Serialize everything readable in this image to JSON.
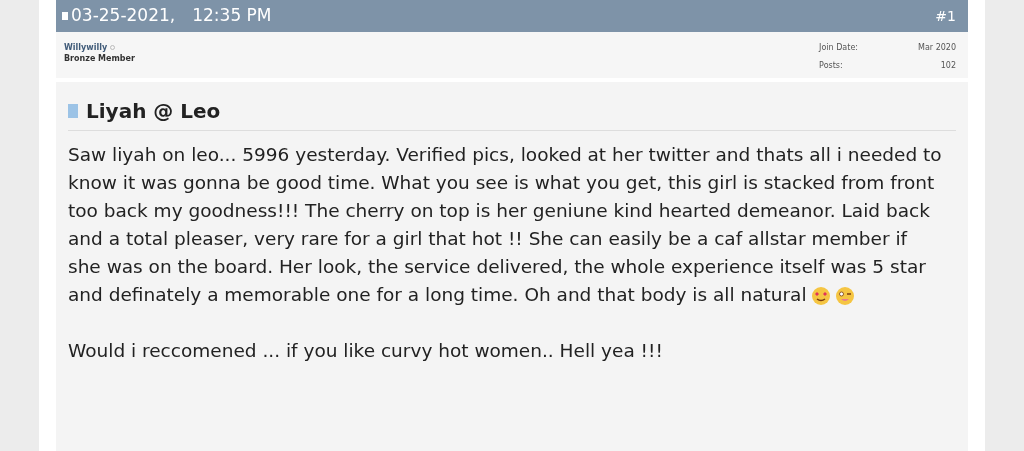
{
  "post_header": {
    "date": "03-25-2021,",
    "time": "12:35 PM",
    "number": "#1"
  },
  "author": {
    "username": "Willywilly",
    "rank": "Bronze Member",
    "online": false
  },
  "user_stats": [
    {
      "label": "Join Date:",
      "value": "Mar 2020"
    },
    {
      "label": "Posts:",
      "value": "102"
    }
  ],
  "post": {
    "title": "Liyah @ Leo",
    "paragraphs": [
      "Saw liyah on leo... 5996 yesterday. Verified pics, looked at her twitter and thats all i needed to know it was gonna be good time. What you see is what you get, this girl is stacked from front too back my goodness!!! The cherry on top is her geniune kind hearted demeanor. Laid back and a total pleaser, very rare for a girl that hot !! She can easily be a caf allstar member if she was on the board. Her look, the service delivered, the whole experience itself was 5 star and definately a memorable one for a long time. Oh and that body is all natural",
      "Would i reccomened ... if you like curvy hot women.. Hell yea !!!"
    ]
  }
}
